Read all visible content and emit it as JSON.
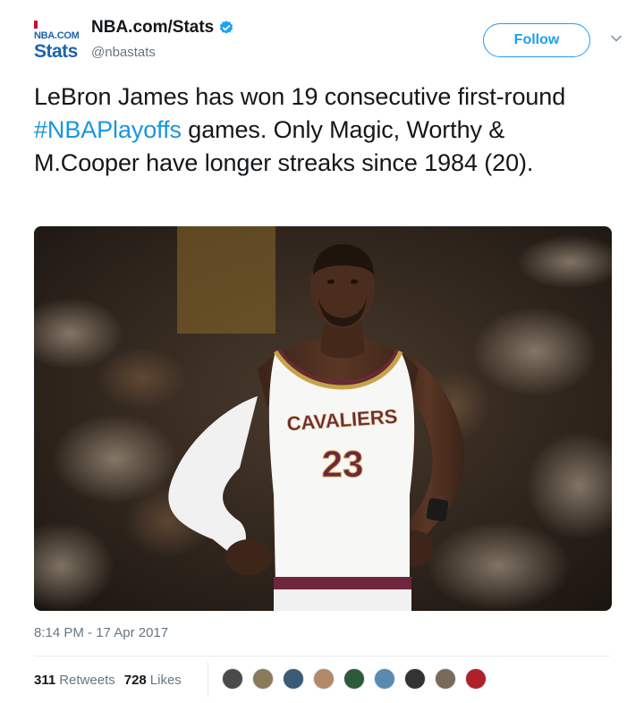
{
  "account": {
    "logo_top": "NBA.COM",
    "logo_bottom": "Stats",
    "display_name": "NBA.com/Stats",
    "handle": "@nbastats",
    "follow_label": "Follow"
  },
  "tweet": {
    "text_before": "LeBron James has won 19 consecutive first-round ",
    "hashtag": "#NBAPlayoffs",
    "text_after": " games. Only Magic, Worthy & M.Cooper have longer streaks since 1984 (20).",
    "photo_jersey_team": "CAVALIERS",
    "photo_jersey_number": "23",
    "timestamp": "8:14 PM - 17 Apr 2017"
  },
  "engagement": {
    "retweets_count": "311",
    "retweets_label": "Retweets",
    "likes_count": "728",
    "likes_label": "Likes"
  },
  "colors": {
    "accent": "#1da1f2",
    "hashtag": "#1b95e0",
    "muted": "#657786",
    "jersey_wine": "#6f263d",
    "jersey_gold": "#c7a24a"
  }
}
